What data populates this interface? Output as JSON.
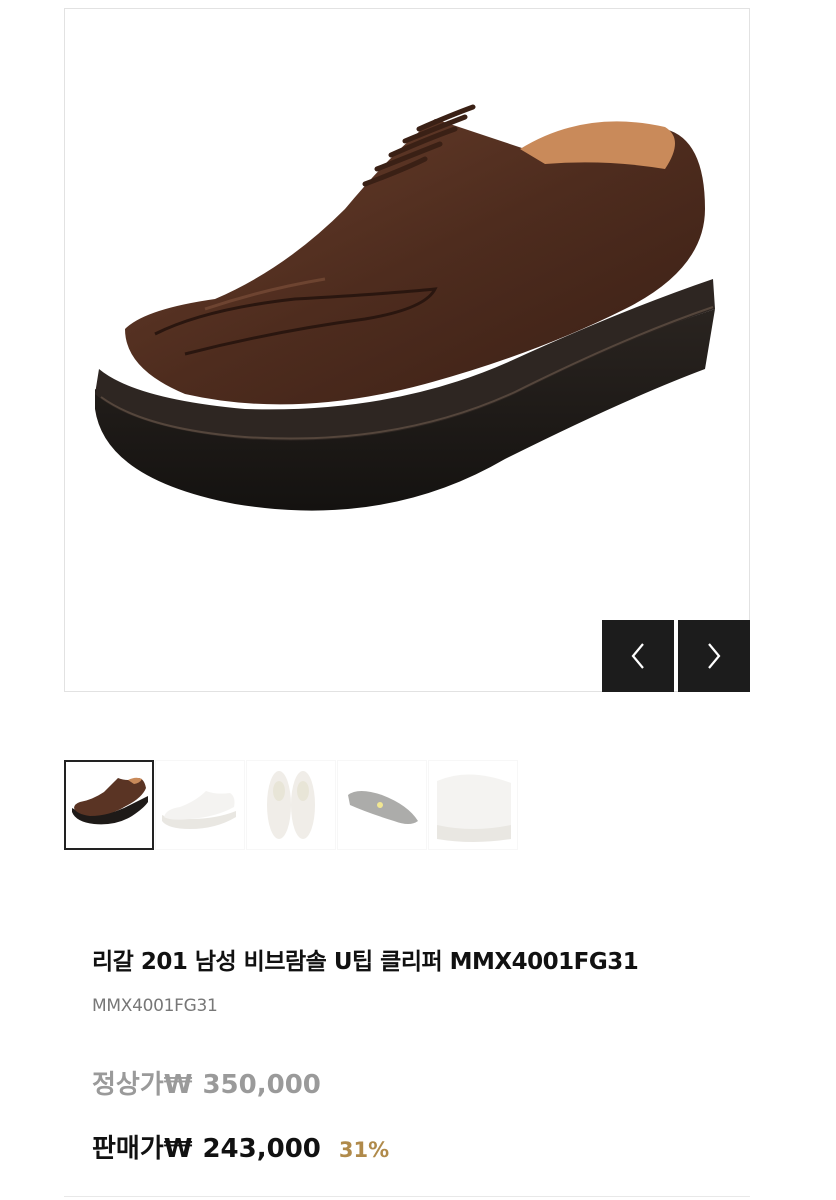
{
  "product": {
    "title": "리갈 201 남성 비브람솔 U팁 클리퍼 MMX4001FG31",
    "code": "MMX4001FG31",
    "image_alt": "brown leather u-tip derby shoe with vibram sole",
    "price": {
      "regular_label": "정상가₩",
      "regular_value": "350,000",
      "sale_label": "판매가₩",
      "sale_value": "243,000",
      "discount": "31%"
    }
  },
  "gallery": {
    "prev_icon": "chevron-left-icon",
    "next_icon": "chevron-right-icon",
    "thumbnails": [
      {
        "name": "thumbnail-side-view",
        "active": true
      },
      {
        "name": "thumbnail-white-side-view",
        "active": false
      },
      {
        "name": "thumbnail-sole-pair-view",
        "active": false
      },
      {
        "name": "thumbnail-outsole-view",
        "active": false
      },
      {
        "name": "thumbnail-front-view",
        "active": false
      }
    ]
  },
  "colors": {
    "accent": "#b08a4a",
    "nav_button": "#1c1c1c",
    "leather": "#4e2c1e"
  }
}
